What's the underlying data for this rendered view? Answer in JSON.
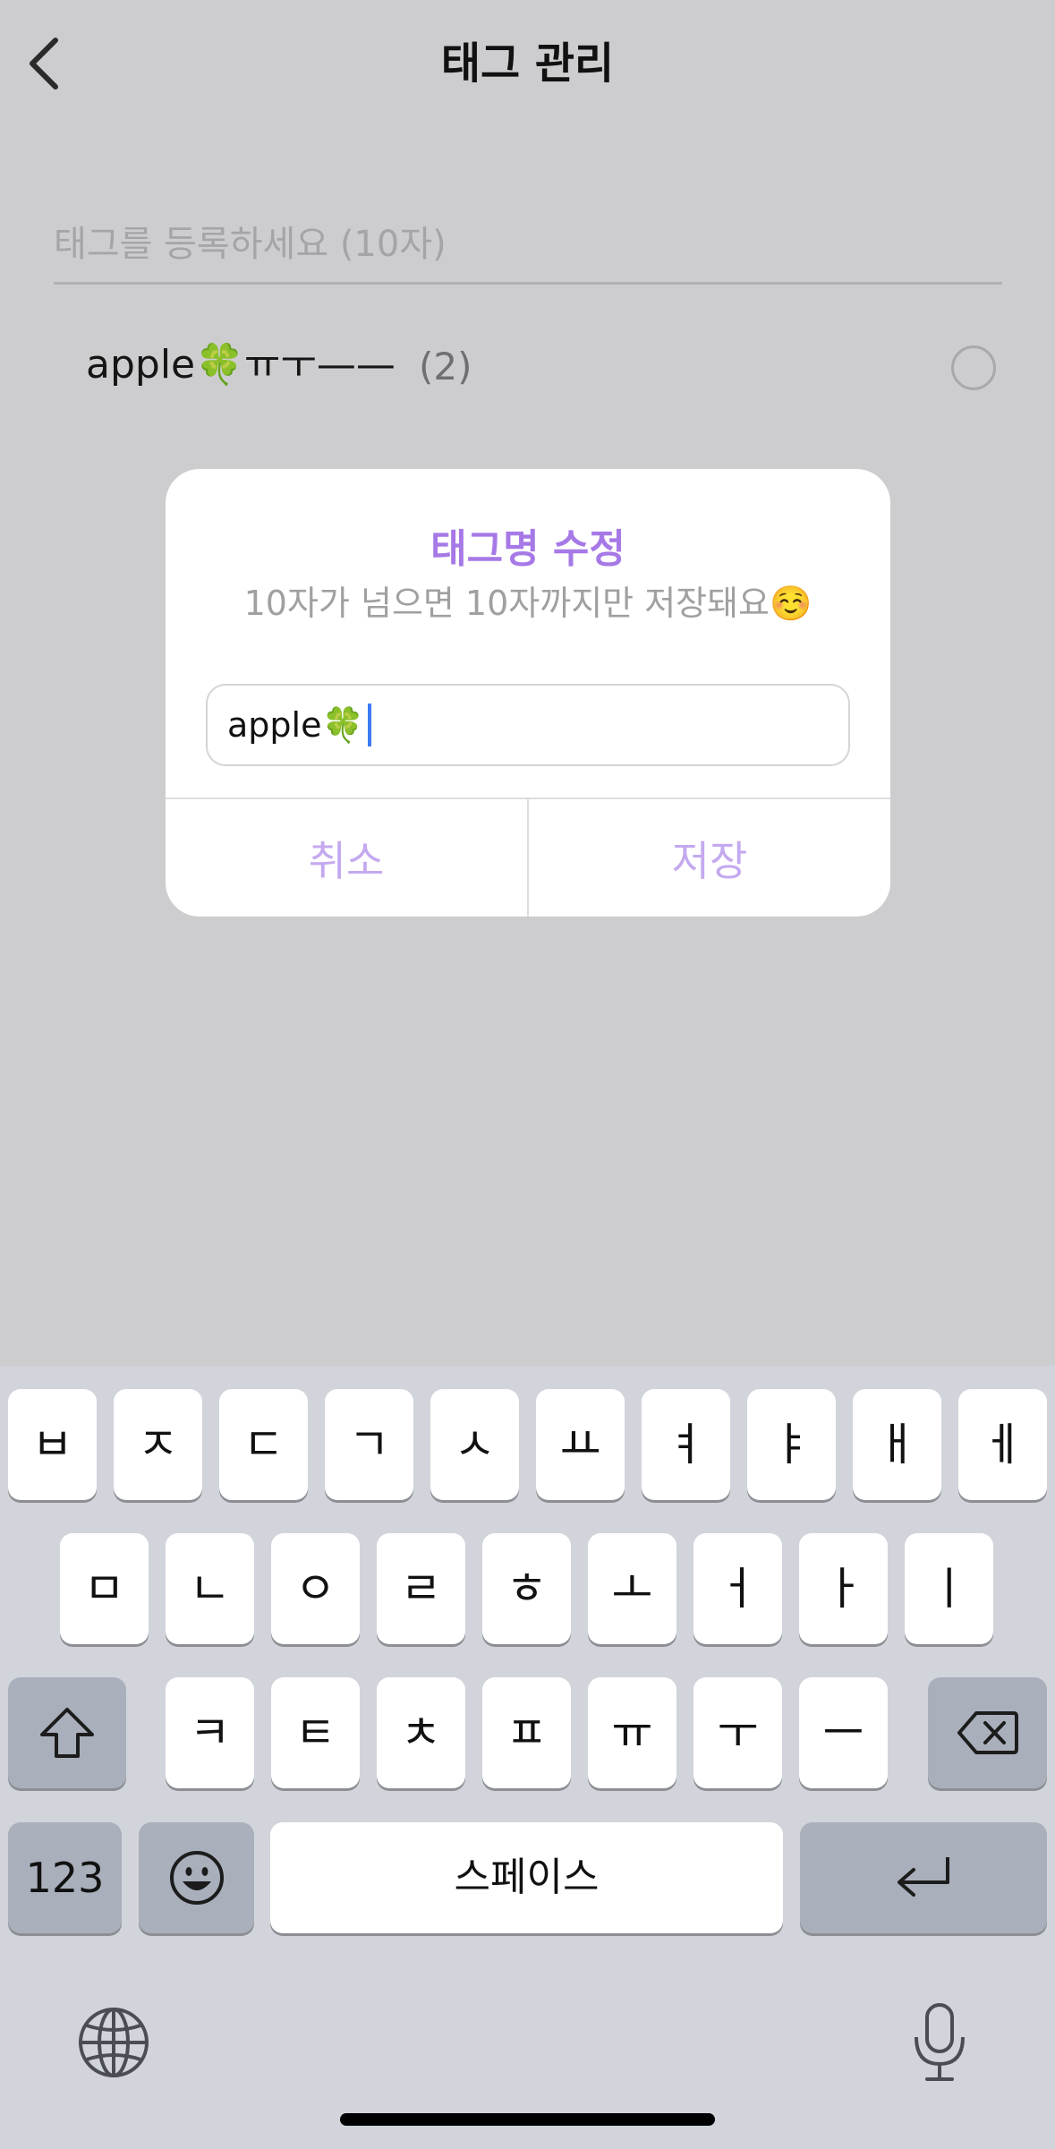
{
  "header": {
    "title": "태그 관리",
    "back_icon": "chevron-left-icon"
  },
  "tag_input": {
    "placeholder": "태그를 등록하세요 (10자)"
  },
  "tags": [
    {
      "name": "apple🍀ㅠㅜ——",
      "count": "(2)"
    }
  ],
  "dialog": {
    "title": "태그명 수정",
    "subtitle": "10자가 넘으면 10자까지만 저장돼요☺️",
    "input_value": "apple🍀",
    "cancel_label": "취소",
    "save_label": "저장",
    "accent_color": "#a679e6"
  },
  "keyboard": {
    "row1": [
      "ㅂ",
      "ㅈ",
      "ㄷ",
      "ㄱ",
      "ㅅ",
      "ㅛ",
      "ㅕ",
      "ㅑ",
      "ㅐ",
      "ㅔ"
    ],
    "row2": [
      "ㅁ",
      "ㄴ",
      "ㅇ",
      "ㄹ",
      "ㅎ",
      "ㅗ",
      "ㅓ",
      "ㅏ",
      "ㅣ"
    ],
    "row3": [
      "ㅋ",
      "ㅌ",
      "ㅊ",
      "ㅍ",
      "ㅠ",
      "ㅜ",
      "ㅡ"
    ],
    "num_label": "123",
    "space_label": "스페이스",
    "shift_icon": "shift-icon",
    "delete_icon": "delete-icon",
    "emoji_icon": "emoji-icon",
    "return_icon": "return-icon",
    "globe_icon": "globe-icon",
    "mic_icon": "microphone-icon"
  }
}
